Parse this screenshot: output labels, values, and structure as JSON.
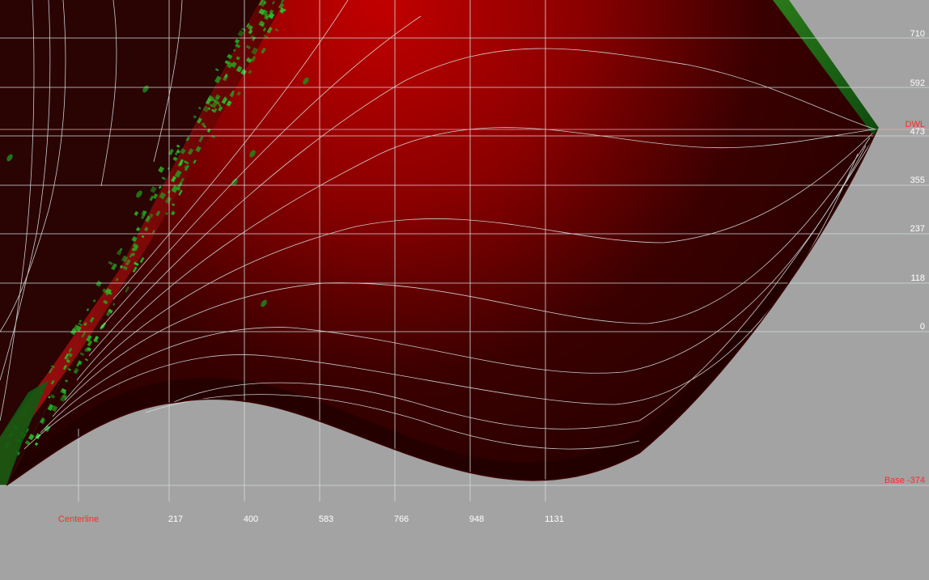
{
  "view": {
    "background_color": "#a3a3a3",
    "hull_color_light": "#c20000",
    "hull_color_dark": "#220000",
    "grid_color": "#d2dcdc",
    "reference_color": "#ff2a2a",
    "mesh_color": "#1fa81f"
  },
  "waterlines": [
    {
      "label": "710",
      "color": "#ffffff"
    },
    {
      "label": "592",
      "color": "#ffffff"
    },
    {
      "label": "473",
      "color": "#ffffff"
    },
    {
      "label": "355",
      "color": "#ffffff"
    },
    {
      "label": "237",
      "color": "#ffffff"
    },
    {
      "label": "118",
      "color": "#ffffff"
    },
    {
      "label": "0",
      "color": "#ffffff"
    }
  ],
  "dwl": {
    "label": "DWL",
    "color": "#ff2a2a"
  },
  "base": {
    "label": "Base -374",
    "color": "#ff2a2a"
  },
  "stations": [
    {
      "label": "Centerline",
      "color": "#ff2a2a"
    },
    {
      "label": "217",
      "color": "#ffffff"
    },
    {
      "label": "400",
      "color": "#ffffff"
    },
    {
      "label": "583",
      "color": "#ffffff"
    },
    {
      "label": "766",
      "color": "#ffffff"
    },
    {
      "label": "948",
      "color": "#ffffff"
    },
    {
      "label": "1131",
      "color": "#ffffff"
    }
  ]
}
